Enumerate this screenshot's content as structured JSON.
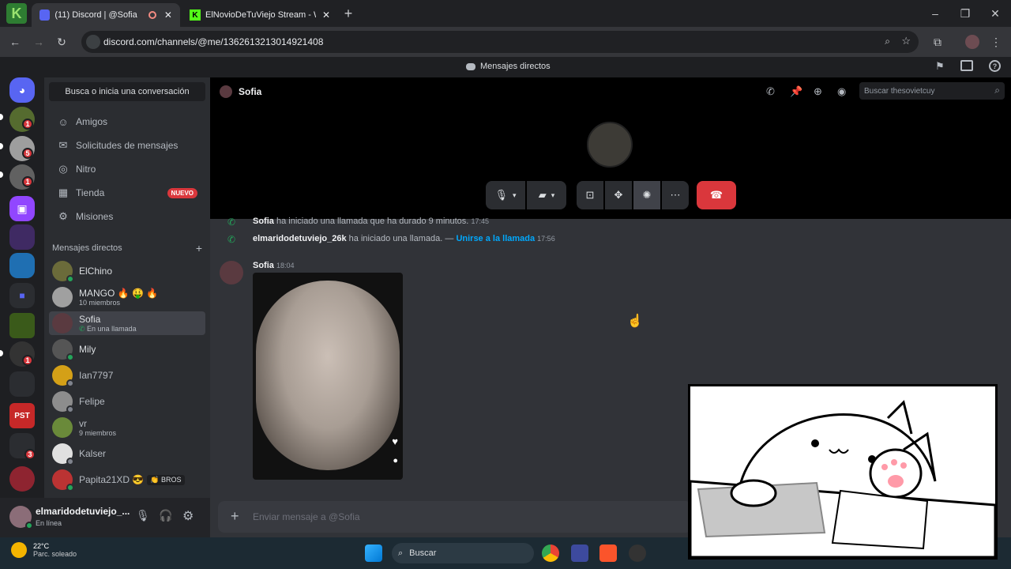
{
  "browser": {
    "tabs": [
      {
        "title": "(11) Discord | @Sofia"
      },
      {
        "title": "ElNovioDeTuViejo Stream - Wa"
      }
    ],
    "url": "discord.com/channels/@me/1362613213014921408"
  },
  "discord": {
    "top_title": "Mensajes directos",
    "guild_badges": [
      "1",
      "5",
      "1",
      "1",
      "3"
    ],
    "sidebar": {
      "search_label": "Busca o inicia una conversación",
      "nav": [
        {
          "label": "Amigos",
          "icon": "friends-icon"
        },
        {
          "label": "Solicitudes de mensajes",
          "icon": "mail-icon"
        },
        {
          "label": "Nitro",
          "icon": "nitro-icon"
        },
        {
          "label": "Tienda",
          "icon": "shop-icon",
          "badge": "NUEVO"
        },
        {
          "label": "Misiones",
          "icon": "quests-icon"
        }
      ],
      "dm_header": "Mensajes directos",
      "dms": [
        {
          "name": "ElChino",
          "sub": ""
        },
        {
          "name": "MANGO 🔥 🤑 🔥",
          "sub": "10 miembros"
        },
        {
          "name": "Sofia",
          "sub": "En una llamada"
        },
        {
          "name": "Mily",
          "sub": ""
        },
        {
          "name": "Ian7797",
          "sub": ""
        },
        {
          "name": "Felipe",
          "sub": ""
        },
        {
          "name": "vr",
          "sub": "9 miembros"
        },
        {
          "name": "Kalser",
          "sub": ""
        },
        {
          "name": "Papita21XD 😎",
          "sub": "",
          "tag": "👏 BROS"
        }
      ]
    },
    "user_panel": {
      "username": "elmaridodetuviejo_...",
      "status": "En línea"
    },
    "channel": {
      "name": "Sofia",
      "search_placeholder": "Buscar thesovietcuy"
    },
    "messages": [
      {
        "author": "Sofia",
        "text": "ha iniciado una llamada que ha durado 9 minutos.",
        "time": "17:45"
      },
      {
        "author": "elmaridodetuviejo_26k",
        "text": "ha iniciado una llamada. —",
        "link": "Unirse a la llamada",
        "time": "17:56"
      },
      {
        "author": "Sofia",
        "time": "18:04"
      }
    ],
    "composer_placeholder": "Enviar mensaje a @Sofia"
  },
  "taskbar": {
    "weather_temp": "22°C",
    "weather_desc": "Parc. soleado",
    "search_label": "Buscar"
  },
  "colors": {
    "accent": "#5865f2",
    "danger": "#da373c",
    "online": "#23a55a",
    "link": "#00a8fc"
  }
}
